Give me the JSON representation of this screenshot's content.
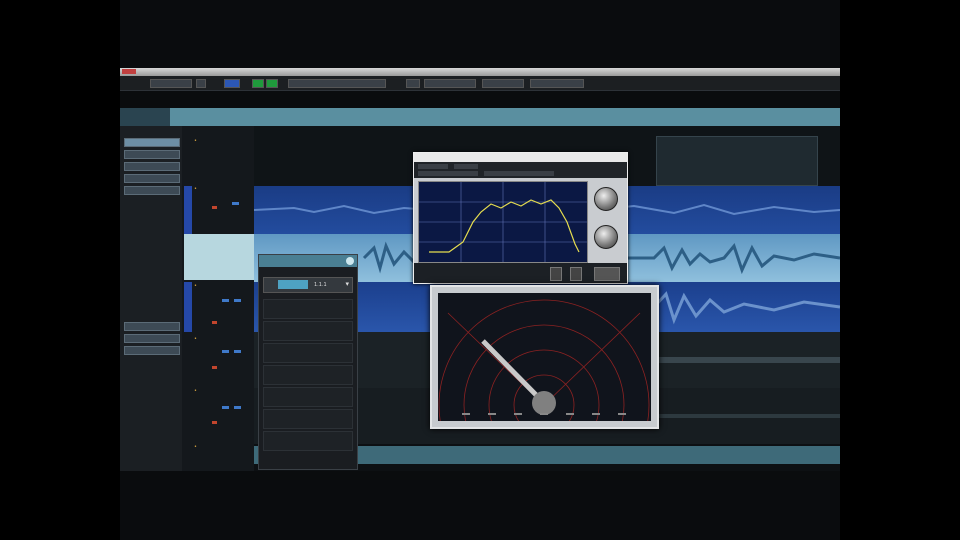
{
  "colors": {
    "ruler": "#5a8fa0",
    "track_blue": "#1b3f8a",
    "track_highlight": "#7fb6d4",
    "eq_curve": "#e6dd4f",
    "scope_needle": "#c9c9c9",
    "scope_rings": "#a52a2a"
  },
  "picker": {
    "value": "1.1.1"
  },
  "icons": [
    "close-icon",
    "dropdown-arrow-icon",
    "knob-icon",
    "meter-icon"
  ]
}
